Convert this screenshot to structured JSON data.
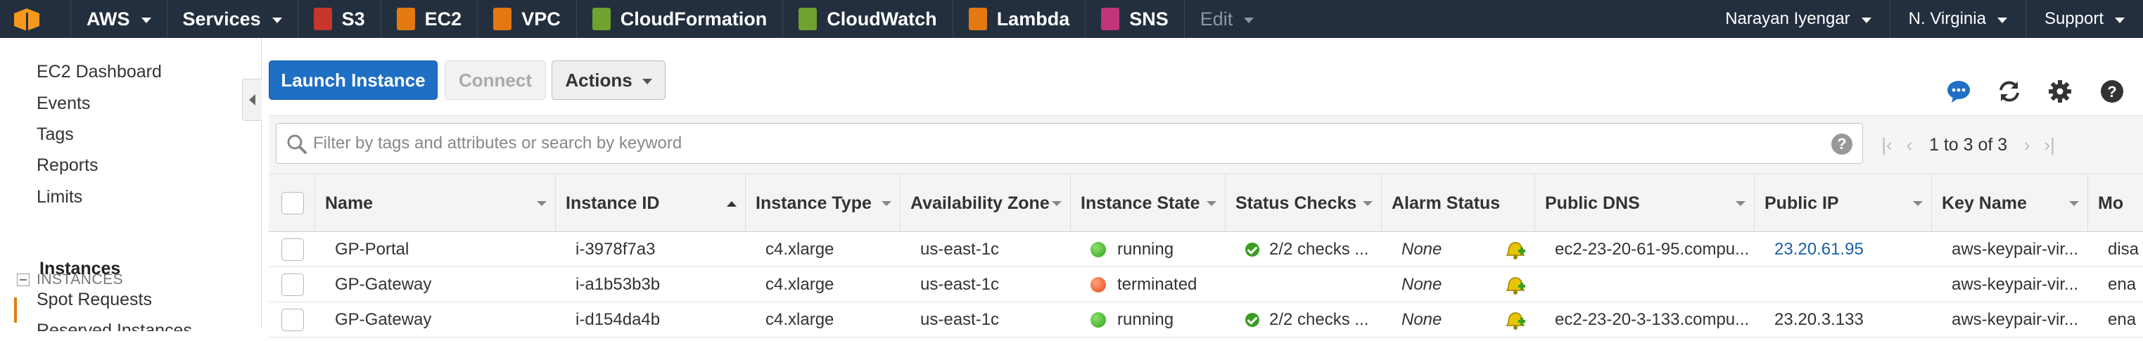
{
  "topnav": {
    "items": [
      {
        "label": "AWS",
        "caret": true
      },
      {
        "label": "Services",
        "caret": true
      },
      {
        "label": "S3",
        "icon": "s3-icon",
        "color": "#c7352b"
      },
      {
        "label": "EC2",
        "icon": "ec2-icon",
        "color": "#e47911"
      },
      {
        "label": "VPC",
        "icon": "vpc-icon",
        "color": "#e47911"
      },
      {
        "label": "CloudFormation",
        "icon": "cloudformation-icon",
        "color": "#6fa22f"
      },
      {
        "label": "CloudWatch",
        "icon": "cloudwatch-icon",
        "color": "#6fa22f"
      },
      {
        "label": "Lambda",
        "icon": "lambda-icon",
        "color": "#e47911"
      },
      {
        "label": "SNS",
        "icon": "sns-icon",
        "color": "#c2357d"
      },
      {
        "label": "Edit",
        "caret": true
      }
    ],
    "user": "Narayan Iyengar",
    "region": "N. Virginia",
    "support": "Support"
  },
  "sidebar": {
    "links": [
      "EC2 Dashboard",
      "Events",
      "Tags",
      "Reports",
      "Limits"
    ],
    "section": "INSTANCES",
    "section_items": [
      "Instances",
      "Spot Requests",
      "Reserved Instances"
    ]
  },
  "toolbar": {
    "launch_label": "Launch Instance",
    "connect_label": "Connect",
    "actions_label": "Actions"
  },
  "search": {
    "placeholder": "Filter by tags and attributes or search by keyword",
    "help": "?"
  },
  "pager": {
    "text": "1 to 3 of 3"
  },
  "table": {
    "columns": [
      "Name",
      "Instance ID",
      "Instance Type",
      "Availability Zone",
      "Instance State",
      "Status Checks",
      "Alarm Status",
      "Public DNS",
      "Public IP",
      "Key Name",
      "Mo"
    ],
    "rows": [
      {
        "name": "GP-Portal",
        "id": "i-3978f7a3",
        "type": "c4.xlarge",
        "az": "us-east-1c",
        "state": "running",
        "state_color": "green",
        "checks": "2/2 checks ...",
        "alarm": "None",
        "dns": "ec2-23-20-61-95.compu...",
        "ip": "23.20.61.95",
        "ip_link": true,
        "key": "aws-keypair-vir...",
        "mo": "disa"
      },
      {
        "name": "GP-Gateway",
        "id": "i-a1b53b3b",
        "type": "c4.xlarge",
        "az": "us-east-1c",
        "state": "terminated",
        "state_color": "red",
        "checks": "",
        "alarm": "None",
        "dns": "",
        "ip": "",
        "ip_link": false,
        "key": "aws-keypair-vir...",
        "mo": "ena"
      },
      {
        "name": "GP-Gateway",
        "id": "i-d154da4b",
        "type": "c4.xlarge",
        "az": "us-east-1c",
        "state": "running",
        "state_color": "green",
        "checks": "2/2 checks ...",
        "alarm": "None",
        "dns": "ec2-23-20-3-133.compu...",
        "ip": "23.20.3.133",
        "ip_link": false,
        "key": "aws-keypair-vir...",
        "mo": "ena"
      }
    ]
  }
}
